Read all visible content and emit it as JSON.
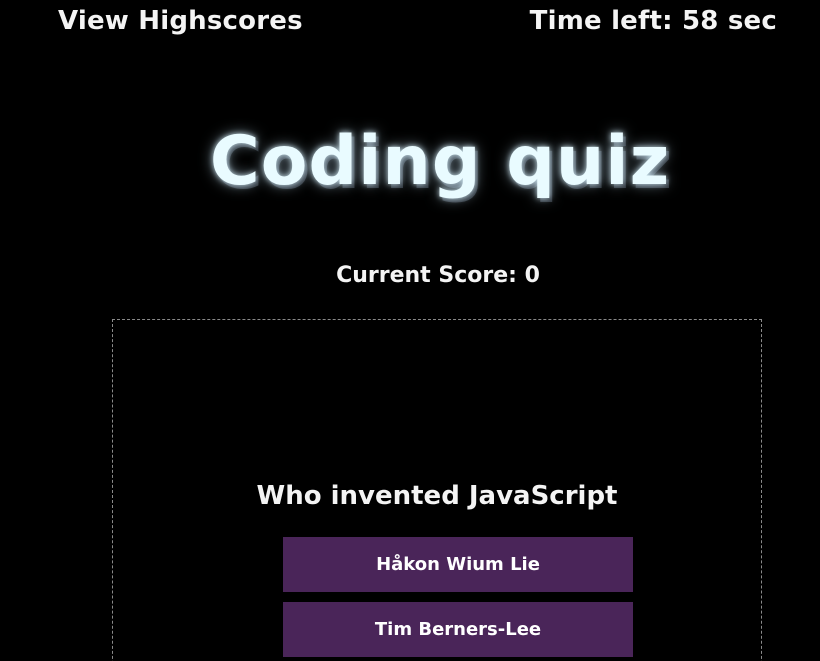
{
  "header": {
    "highscores_link": "View Highscores",
    "timer_label": "Time left:",
    "timer_value": "58",
    "timer_unit": "sec"
  },
  "main": {
    "title": "Coding quiz",
    "score_label": "Current Score:",
    "score_value": "0"
  },
  "quiz": {
    "question": "Who invented JavaScript",
    "answers": [
      "Håkon Wium Lie",
      "Tim Berners-Lee"
    ]
  },
  "colors": {
    "background": "#000000",
    "text": "#f4f4f4",
    "title_glow": "#e9fbff",
    "answer_button_bg": "#4a2559",
    "quiz_border": "#8a8a8a"
  }
}
